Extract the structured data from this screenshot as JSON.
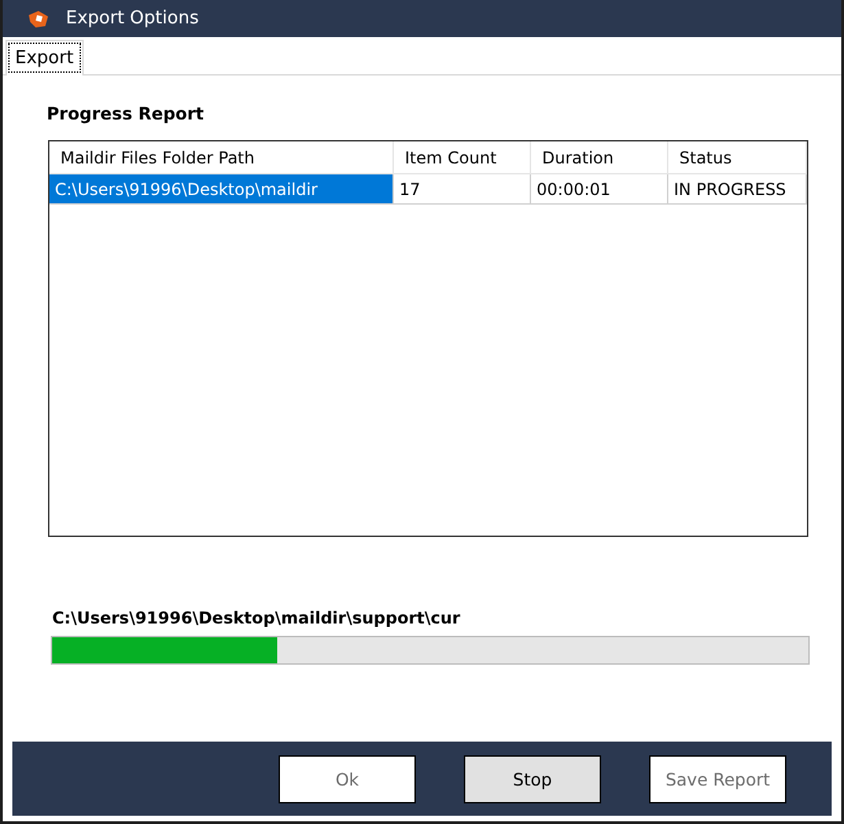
{
  "window": {
    "title": "Export Options"
  },
  "tabs": [
    {
      "label": "Export",
      "selected": true
    }
  ],
  "progress_report": {
    "title": "Progress Report",
    "columns": [
      "Maildir Files Folder Path",
      "Item Count",
      "Duration",
      "Status"
    ],
    "rows": [
      {
        "selected": true,
        "cells": [
          "C:\\Users\\91996\\Desktop\\maildir",
          "17",
          "00:00:01",
          "IN PROGRESS"
        ]
      }
    ]
  },
  "current_path": "C:\\Users\\91996\\Desktop\\maildir\\support\\cur",
  "progress": {
    "level": 0.297
  },
  "buttons": [
    {
      "label": "Ok",
      "disabled": true
    },
    {
      "label": "Stop",
      "disabled": false
    },
    {
      "label": "Save Report",
      "disabled": true
    }
  ]
}
